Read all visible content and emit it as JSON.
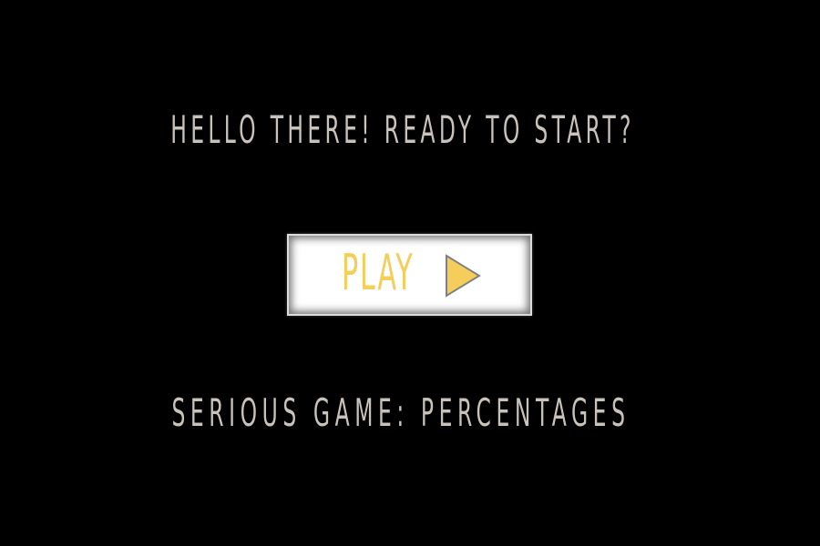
{
  "screen": {
    "headline": "HELLO THERE! READY TO START?",
    "subtitle": "SERIOUS GAME: PERCENTAGES"
  },
  "play_button": {
    "label": "PLAY",
    "icon": "play-triangle-icon"
  },
  "colors": {
    "background": "#000000",
    "text": "#c8c2ba",
    "accent": "#f5cd5a",
    "button_bg": "#ffffff"
  }
}
